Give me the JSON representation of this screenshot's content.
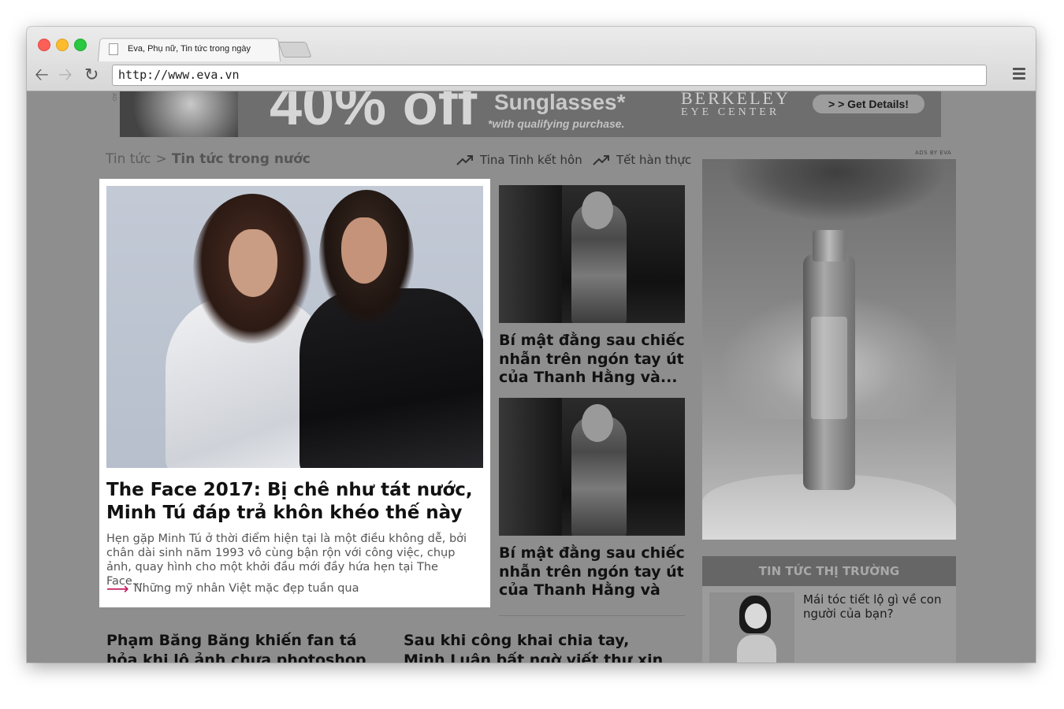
{
  "browser": {
    "tab_title": "Eva, Phụ nữ, Tin tức trong ngày",
    "url": "http://www.eva.vn"
  },
  "banner_ad": {
    "big_text": "40% off",
    "product": "Sunglasses*",
    "qualifier": "*with qualifying purchase.",
    "brand_line1": "BERKELEY",
    "brand_line2": "EYE CENTER",
    "cta": "> > Get Details!",
    "ad_mark": "AD"
  },
  "breadcrumb": {
    "root": "Tin tức",
    "separator": ">",
    "current": "Tin tức trong nước"
  },
  "trending": [
    {
      "label": "Tina Tinh kết hôn",
      "icon": "trending-up-icon"
    },
    {
      "label": "Tết hàn thực",
      "icon": "trending-up-icon"
    }
  ],
  "featured": {
    "title": "The Face 2017: Bị chê như tát nước, Minh Tú đáp trả khôn khéo thế này",
    "description": "Hẹn gặp Minh Tú ở thời điểm hiện tại là một điều không dễ, bởi chân dài sinh năm 1993 vô cùng bận rộn với công việc, chụp ảnh, quay hình cho một khởi đầu mới đầy hứa hẹn tại The Face...",
    "related_link": "Những mỹ nhân Việt mặc đẹp tuần qua"
  },
  "side_articles": [
    {
      "title": "Bí mật đằng sau chiếc nhẫn trên ngón tay út của Thanh Hằng và..."
    },
    {
      "title": "Bí mật đằng sau chiếc nhẫn trên ngón tay út của Thanh Hằng và"
    }
  ],
  "bottom_articles": [
    {
      "title": "Phạm Băng Băng khiến fan tá hỏa khi lộ ảnh chưa photoshop"
    },
    {
      "title": "Sau khi công khai chia tay, Minh Luân bất ngờ viết thư xin lỗi"
    }
  ],
  "sidebar": {
    "ads_by": "ADS BY EVA",
    "market_header": "TIN TỨC THỊ TRƯỜNG",
    "market_item": "Mái tóc tiết lộ gì về con người của bạn?"
  }
}
